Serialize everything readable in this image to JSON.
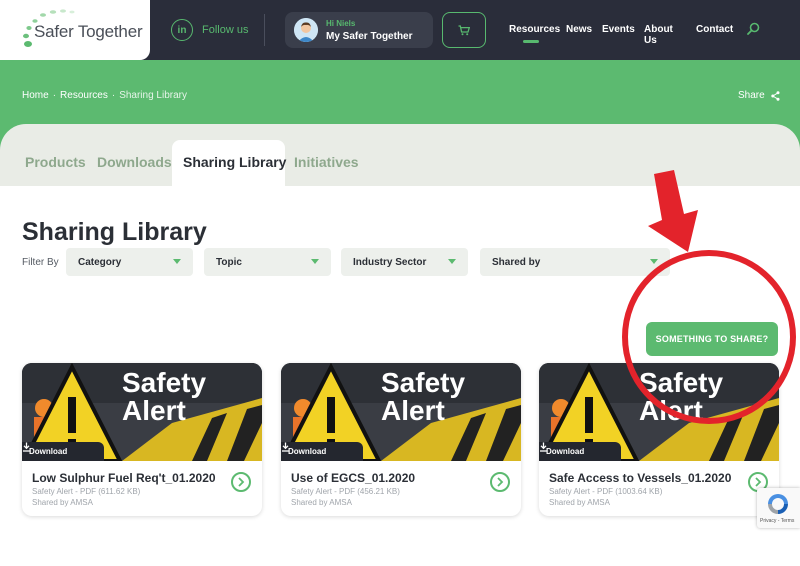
{
  "header": {
    "logo_text": "Safer Together",
    "follow_label": "Follow us",
    "linkedin_label": "in",
    "greeting": "Hi Niels",
    "account_label": "My Safer Together",
    "nav": [
      "Resources",
      "News",
      "Events",
      "About Us",
      "Contact"
    ],
    "active_nav": "Resources"
  },
  "breadcrumb": {
    "items": [
      "Home",
      "Resources",
      "Sharing Library"
    ],
    "separator": "·"
  },
  "share_label": "Share",
  "tabs": [
    {
      "label": "Products",
      "active": false
    },
    {
      "label": "Downloads",
      "active": false
    },
    {
      "label": "Sharing Library",
      "active": true
    },
    {
      "label": "Initiatives",
      "active": false
    }
  ],
  "page_title": "Sharing Library",
  "filter_label": "Filter By",
  "filters": [
    {
      "label": "Category"
    },
    {
      "label": "Topic"
    },
    {
      "label": "Industry Sector"
    },
    {
      "label": "Shared by"
    }
  ],
  "share_button_label": "SOMETHING TO SHARE?",
  "cards": [
    {
      "image_text_1": "Safety",
      "image_text_2": "Alert",
      "download_label": "Download",
      "title": "Low Sulphur Fuel Req't_01.2020",
      "meta": "Safety Alert - PDF (611.62 KB)",
      "shared_by": "Shared by AMSA"
    },
    {
      "image_text_1": "Safety",
      "image_text_2": "Alert",
      "download_label": "Download",
      "title": "Use of EGCS_01.2020",
      "meta": "Safety Alert - PDF (456.21 KB)",
      "shared_by": "Shared by AMSA"
    },
    {
      "image_text_1": "Safety",
      "image_text_2": "Alert",
      "download_label": "Download",
      "title": "Safe Access to Vessels_01.2020",
      "meta": "Safety Alert - PDF (1003.64 KB)",
      "shared_by": "Shared by AMSA"
    }
  ],
  "recaptcha_label": "Privacy - Terms",
  "colors": {
    "brand_green": "#5cba70",
    "header_dark": "#2a2d3a",
    "annotation_red": "#e3232b"
  }
}
